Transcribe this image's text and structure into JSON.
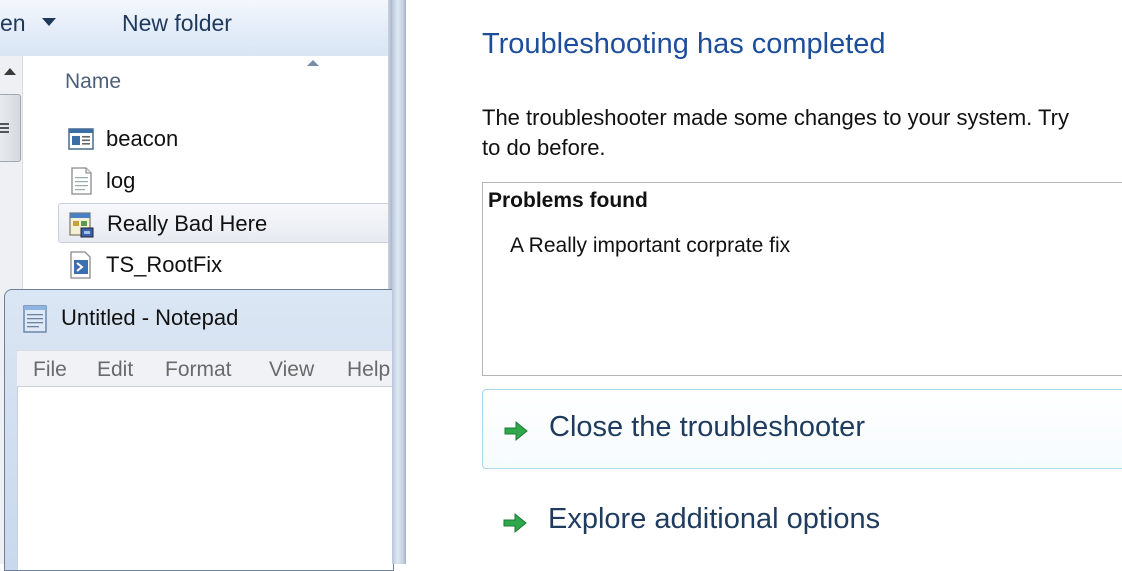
{
  "explorer": {
    "toolbar": {
      "open_label": "en",
      "new_folder_label": "New folder"
    },
    "column_header": "Name",
    "files": [
      {
        "label": "beacon",
        "icon": "window-app-icon"
      },
      {
        "label": "log",
        "icon": "text-document-icon"
      },
      {
        "label": "Really Bad Here",
        "icon": "troubleshooting-pack-icon",
        "selected": true
      },
      {
        "label": "TS_RootFix",
        "icon": "powershell-script-icon"
      }
    ]
  },
  "notepad": {
    "title": "Untitled - Notepad",
    "menu": [
      "File",
      "Edit",
      "Format",
      "View",
      "Help"
    ]
  },
  "troubleshooter": {
    "heading": "Troubleshooting has completed",
    "description": "The troubleshooter made some changes to your system. Try\nto do before.",
    "problems_header": "Problems found",
    "problems": [
      "A Really important corprate fix"
    ],
    "actions": {
      "close": "Close the troubleshooter",
      "explore": "Explore additional options"
    },
    "colors": {
      "heading": "#1d4e9c",
      "arrow": "#2ea84a",
      "hover_border": "#a8d8ea"
    }
  }
}
